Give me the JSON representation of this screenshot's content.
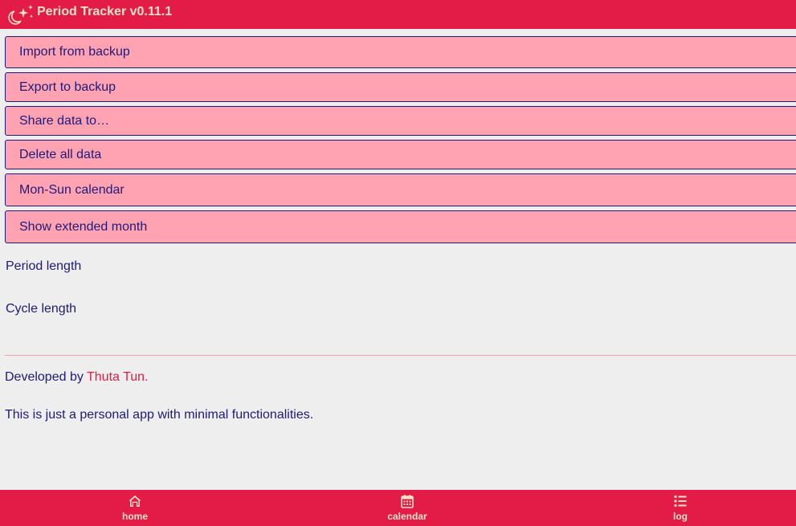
{
  "app": {
    "title": "Period Tracker v0.11.1",
    "logo_icon": "moon-sparkles-icon"
  },
  "settings": {
    "buttons": [
      {
        "label": "Import from backup"
      },
      {
        "label": "Export to backup"
      },
      {
        "label": "Share data to…"
      },
      {
        "label": "Delete all data"
      },
      {
        "label": "Mon-Sun calendar"
      },
      {
        "label": "Show extended month"
      }
    ],
    "period_length_label": "Period length",
    "cycle_length_label": "Cycle length"
  },
  "about": {
    "developed_by_prefix": "Developed by ",
    "author": "Thuta Tun",
    "developed_by_suffix": ".",
    "note": "This is just a personal app with minimal functionalities."
  },
  "nav": {
    "items": [
      {
        "label": "home",
        "icon": "home-icon"
      },
      {
        "label": "calendar",
        "icon": "calendar-icon"
      },
      {
        "label": "log",
        "icon": "list-icon"
      }
    ]
  },
  "colors": {
    "accent": "#e31b47",
    "button_bg": "#ffa3b2",
    "text": "#1f1a78",
    "header_text": "#f7e3c6",
    "background": "#eeeeee"
  }
}
